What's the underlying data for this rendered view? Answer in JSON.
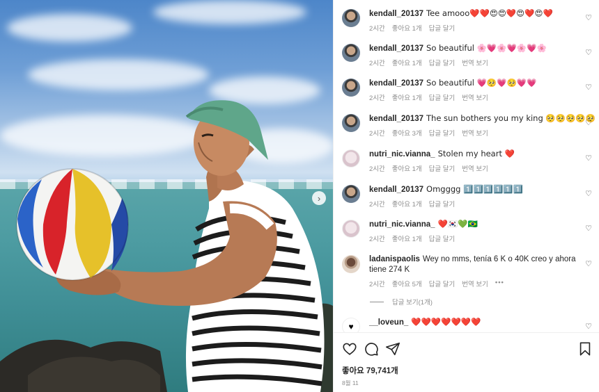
{
  "photo": {
    "next_icon": "chevron-right-icon",
    "sky_color": "#6f9fd6",
    "sea_color": "#4c9ba1",
    "cap_color": "#5fa68a"
  },
  "comments": [
    {
      "avatar": "k",
      "username": "kendall_20137",
      "text": "Tee amooo❤️❤️😍😍❤️😍❤️😍❤️",
      "time": "2시간",
      "likes": "좋아요 1개",
      "reply": "답글 달기",
      "translate": ""
    },
    {
      "avatar": "k",
      "username": "kendall_20137",
      "text": "So beautiful 🌸💗🌸💗🌸💗🌸",
      "time": "2시간",
      "likes": "좋아요 1개",
      "reply": "답글 달기",
      "translate": "번역 보기"
    },
    {
      "avatar": "k",
      "username": "kendall_20137",
      "text": "So beautiful 💗🥺💗🥺💗💗",
      "time": "2시간",
      "likes": "좋아요 1개",
      "reply": "답글 달기",
      "translate": "번역 보기"
    },
    {
      "avatar": "k",
      "username": "kendall_20137",
      "text": "The sun bothers you my king 🥺🥺🥺🥺🥺",
      "time": "2시간",
      "likes": "좋아요 3개",
      "reply": "답글 달기",
      "translate": "번역 보기"
    },
    {
      "avatar": "n",
      "username": "nutri_nic.vianna_",
      "text": "Stolen my heart ❤️",
      "time": "2시간",
      "likes": "좋아요 1개",
      "reply": "답글 달기",
      "translate": "번역 보기"
    },
    {
      "avatar": "k",
      "username": "kendall_20137",
      "text": "Omgggg 1️⃣1️⃣1️⃣1️⃣1️⃣1️⃣",
      "time": "2시간",
      "likes": "좋아요 1개",
      "reply": "답글 달기",
      "translate": ""
    },
    {
      "avatar": "n",
      "username": "nutri_nic.vianna_",
      "text": "❤️🇰🇷💚🇧🇷",
      "time": "2시간",
      "likes": "좋아요 1개",
      "reply": "답글 달기",
      "translate": ""
    },
    {
      "avatar": "l",
      "username": "ladanispaolis",
      "text": "Wey no mms, tenía 6 K o 40K creo y ahora tiene 274 K",
      "time": "2시간",
      "likes": "좋아요 5개",
      "reply": "답글 달기",
      "translate": "번역 보기",
      "more": "•••"
    },
    {
      "avatar": "lv",
      "username": "__loveun_",
      "text": "❤️❤️❤️❤️❤️❤️❤️",
      "time": "",
      "likes": "",
      "reply": "",
      "translate": ""
    }
  ],
  "view_replies": "답글 보기(1개)",
  "actions": {
    "like_icon": "heart-icon",
    "comment_icon": "comment-icon",
    "share_icon": "send-icon",
    "save_icon": "bookmark-icon",
    "likes_label": "좋아요 79,741개",
    "date": "8월 11"
  }
}
